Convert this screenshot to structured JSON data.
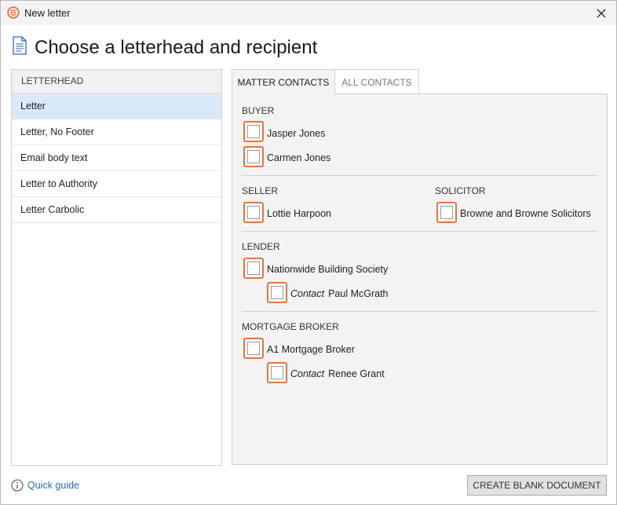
{
  "window": {
    "title": "New letter"
  },
  "heading": "Choose a letterhead and recipient",
  "letterhead": {
    "header": "LETTERHEAD",
    "items": [
      "Letter",
      "Letter, No Footer",
      "Email body text",
      "Letter to Authority",
      "Letter Carbolic"
    ],
    "selected": "Letter"
  },
  "tabs": {
    "matter": "MATTER CONTACTS",
    "all": "ALL CONTACTS",
    "active": "MATTER CONTACTS"
  },
  "sections": {
    "buyer": {
      "label": "BUYER",
      "contacts": [
        "Jasper Jones",
        "Carmen Jones"
      ]
    },
    "seller": {
      "label": "SELLER",
      "contacts": [
        "Lottie Harpoon"
      ]
    },
    "solicitor": {
      "label": "SOLICITOR",
      "contacts": [
        "Browne and Browne Solicitors"
      ]
    },
    "lender": {
      "label": "LENDER",
      "name": "Nationwide Building Society",
      "contact_role": "Contact",
      "contact_name": "Paul McGrath"
    },
    "broker": {
      "label": "MORTGAGE BROKER",
      "name": "A1 Mortgage Broker",
      "contact_role": "Contact",
      "contact_name": "Renee Grant"
    }
  },
  "footer": {
    "quick_guide": "Quick guide",
    "create_button": "CREATE BLANK DOCUMENT"
  },
  "colors": {
    "accent_orange": "#e8743b",
    "selected_row": "#d9e9f7",
    "link_blue": "#2a6bb8"
  }
}
